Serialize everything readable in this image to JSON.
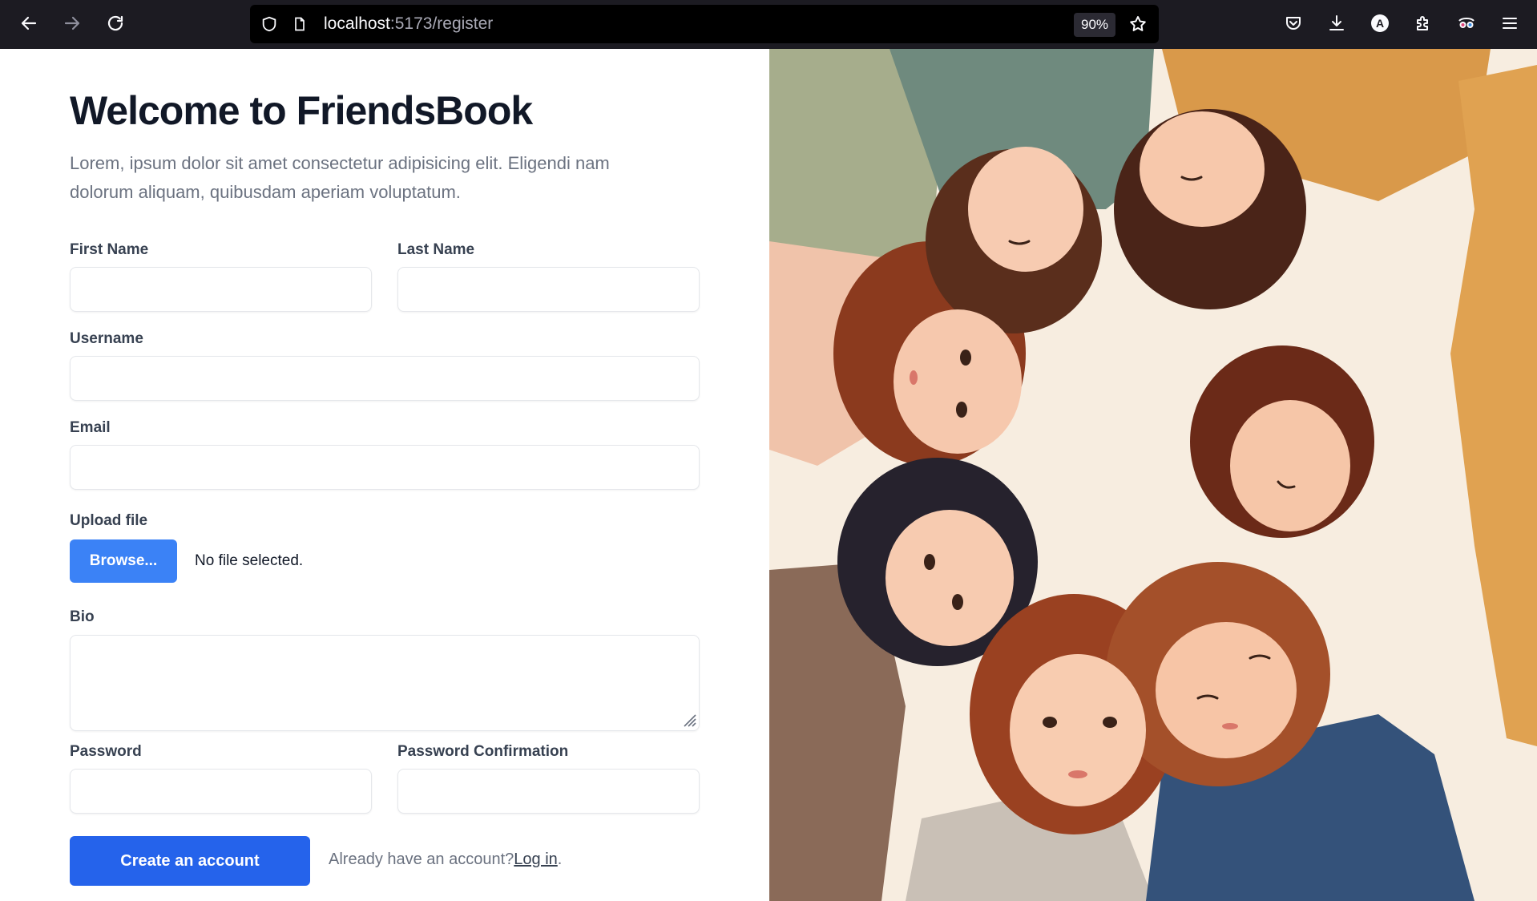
{
  "browser": {
    "url_host": "localhost",
    "url_path": ":5173/register",
    "zoom": "90%",
    "profile_initial": "A"
  },
  "register": {
    "title": "Welcome to FriendsBook",
    "lead": "Lorem, ipsum dolor sit amet consectetur adipisicing elit. Eligendi nam dolorum aliquam, quibusdam aperiam voluptatum.",
    "first_name_label": "First Name",
    "last_name_label": "Last Name",
    "username_label": "Username",
    "email_label": "Email",
    "upload_label": "Upload file",
    "browse_label": "Browse...",
    "file_status": "No file selected.",
    "bio_label": "Bio",
    "password_label": "Password",
    "password_confirm_label": "Password Confirmation",
    "submit_label": "Create an account",
    "login_prompt": "Already have an account?",
    "login_link": "Log in",
    "login_suffix": "."
  },
  "colors": {
    "primary": "#2563eb",
    "browse": "#3b82f6",
    "heading": "#111827",
    "muted": "#6b7280",
    "toolbar": "#1c1b22"
  }
}
